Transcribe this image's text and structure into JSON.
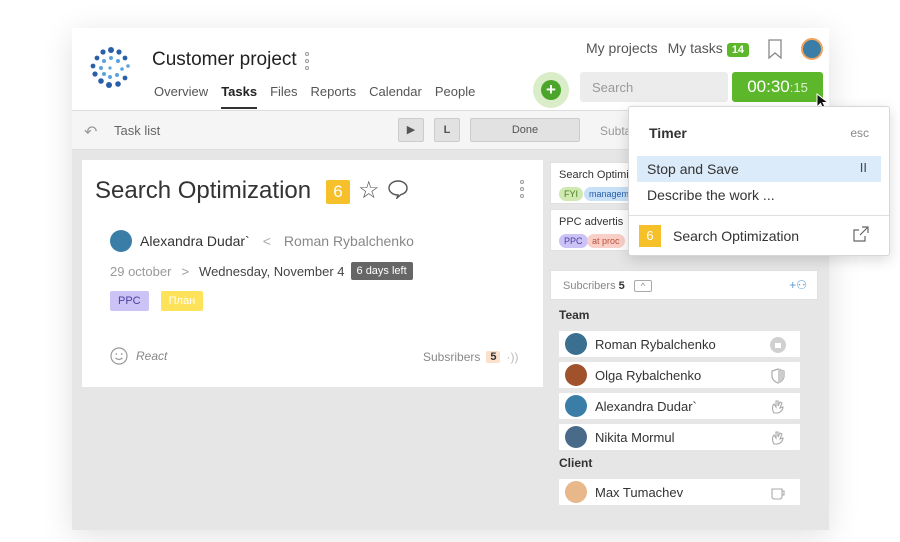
{
  "project": {
    "title": "Customer project"
  },
  "tabs": [
    "Overview",
    "Tasks",
    "Files",
    "Reports",
    "Calendar",
    "People"
  ],
  "top_links": {
    "my_projects": "My projects",
    "my_tasks": "My tasks",
    "my_tasks_count": "14"
  },
  "search": {
    "placeholder": "Search"
  },
  "timer": {
    "time": "00:30",
    "seconds": ":15"
  },
  "toolbar": {
    "task_list": "Task list",
    "play": "▶",
    "l": "L",
    "done": "Done",
    "subtask": "Subta"
  },
  "task": {
    "title": "Search Optimization",
    "number": "6",
    "assignee": "Alexandra Dudar`",
    "sep": "<",
    "author": "Roman Rybalchenko",
    "start": "29 october",
    "arrow": ">",
    "due": "Wednesday, November 4",
    "days_left": "6 days left",
    "tags": [
      "PPC",
      "План"
    ],
    "react": "React",
    "subscribers_label": "Subsribers",
    "subscribers_count": "5"
  },
  "related": [
    {
      "title": "Search Optimi",
      "tags": [
        "FYI",
        "managem"
      ]
    },
    {
      "title": "PPC advertis",
      "tags": [
        "PPC",
        "at proc"
      ]
    }
  ],
  "subscribers": {
    "label": "Subcribers",
    "count": "5",
    "team_label": "Team",
    "team": [
      "Roman Rybalchenko",
      "Olga Rybalchenko",
      "Alexandra Dudar`",
      "Nikita Mormul"
    ],
    "client_label": "Client",
    "client": [
      "Max Tumachev"
    ]
  },
  "popup": {
    "title": "Timer",
    "esc": "esc",
    "stop_save": "Stop and Save",
    "pause": "II",
    "describe": "Describe the work ...",
    "task_number": "6",
    "task_title": "Search Optimization"
  },
  "colors": {
    "green": "#5cb82a",
    "yellow": "#f5c02a",
    "ppc": "#cbc3f5",
    "plan": "#fde25a",
    "selected": "#dcebfa"
  }
}
